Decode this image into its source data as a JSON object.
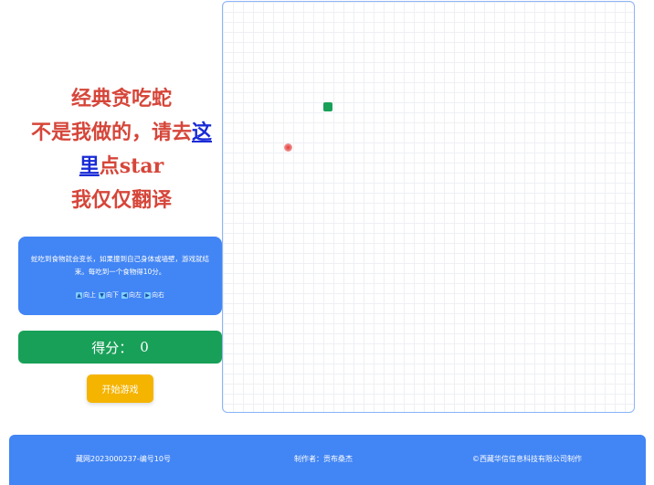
{
  "title": {
    "line1": "经典贪吃蛇",
    "line2_prefix": "不是我做的，请去",
    "link_part1": "这",
    "link_part2": "里",
    "line3_suffix": "点star",
    "line4": "我仅仅翻译"
  },
  "info": {
    "description": "蛇吃到食物就会变长，如果撞到自己身体或墙壁，游戏就结束。每吃到一个食物得10分。",
    "controls": [
      {
        "icon": "up-arrow-icon",
        "label": "向上"
      },
      {
        "icon": "down-arrow-icon",
        "label": "向下"
      },
      {
        "icon": "left-arrow-icon",
        "label": "向左"
      },
      {
        "icon": "right-arrow-icon",
        "label": "向右"
      }
    ]
  },
  "score": {
    "label": "得分：",
    "value": "0"
  },
  "start_button": {
    "label": "开始游戏"
  },
  "board": {
    "grid_cols": 41,
    "grid_rows": 41,
    "snake": [
      {
        "col": 10,
        "row": 10
      }
    ],
    "food": {
      "col": 6,
      "row": 14
    }
  },
  "footer": {
    "left": "藏网2023000237-编号10号",
    "center": "制作者：贡布桑杰",
    "right": "©西藏华信信息科技有限公司制作"
  },
  "colors": {
    "title_red": "#d6463a",
    "link_blue": "#1a2bd6",
    "card_blue": "#4285f4",
    "score_green": "#18a058",
    "start_yellow": "#f5b400"
  }
}
